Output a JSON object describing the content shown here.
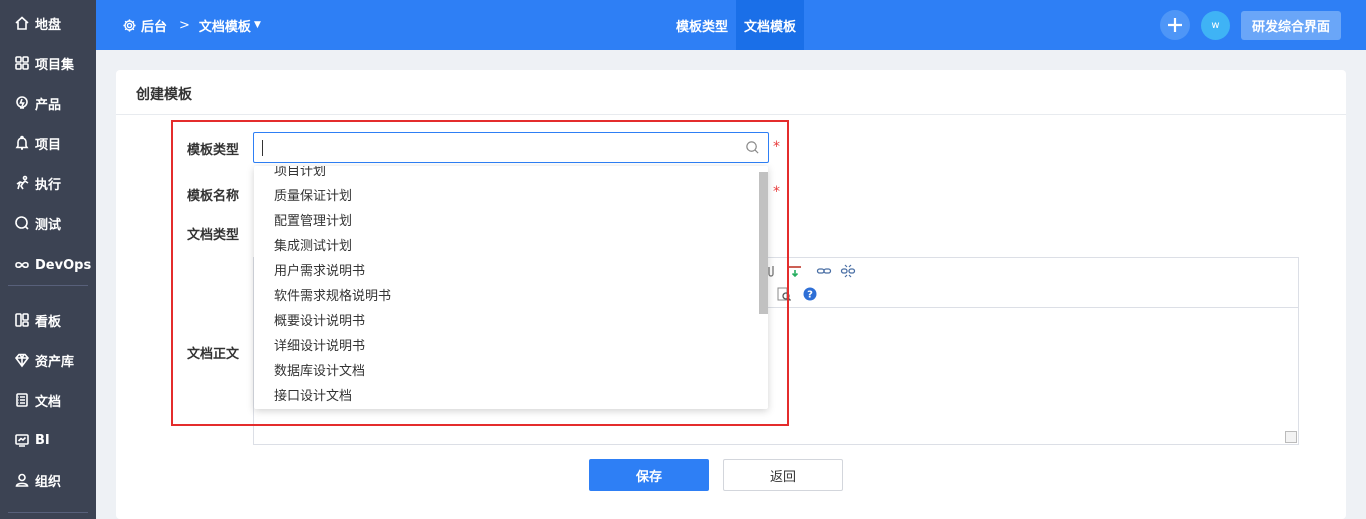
{
  "sidebar": {
    "items": [
      {
        "label": "地盘",
        "icon": "home-icon"
      },
      {
        "label": "项目集",
        "icon": "grid-icon"
      },
      {
        "label": "产品",
        "icon": "lightbulb-icon"
      },
      {
        "label": "项目",
        "icon": "bell-icon"
      },
      {
        "label": "执行",
        "icon": "run-icon"
      },
      {
        "label": "测试",
        "icon": "search-bug-icon"
      },
      {
        "label": "DevOps",
        "icon": "infinity-icon"
      },
      {
        "label": "看板",
        "icon": "kanban-icon"
      },
      {
        "label": "资产库",
        "icon": "diamond-icon"
      },
      {
        "label": "文档",
        "icon": "document-icon"
      },
      {
        "label": "BI",
        "icon": "monitor-icon"
      },
      {
        "label": "组织",
        "icon": "user-icon"
      }
    ]
  },
  "header": {
    "breadcrumb_root": "后台",
    "breadcrumb_separator": ">",
    "breadcrumb_current": "文档模板",
    "tabs": [
      {
        "label": "模板类型",
        "active": false
      },
      {
        "label": "文档模板",
        "active": true
      }
    ],
    "avatar_initial": "w",
    "switch_label": "研发综合界面"
  },
  "card": {
    "title": "创建模板"
  },
  "form": {
    "type_label": "模板类型",
    "name_label": "模板名称",
    "doc_type_label": "文档类型",
    "content_label": "文档正文",
    "required_mark": "*",
    "type_value": "",
    "dropdown_options": [
      "项目计划",
      "质量保证计划",
      "配置管理计划",
      "集成测试计划",
      "用户需求说明书",
      "软件需求规格说明书",
      "概要设计说明书",
      "详细设计说明书",
      "数据库设计文档",
      "接口设计文档"
    ]
  },
  "actions": {
    "save_label": "保存",
    "back_label": "返回"
  },
  "colors": {
    "sidebar_bg": "#3c4353",
    "topbar_bg": "#2e7ff5",
    "active_tab_bg": "#1a6fe8",
    "primary": "#2e7ff5",
    "highlight_border": "#e42c2c",
    "required": "#e83b3b"
  }
}
